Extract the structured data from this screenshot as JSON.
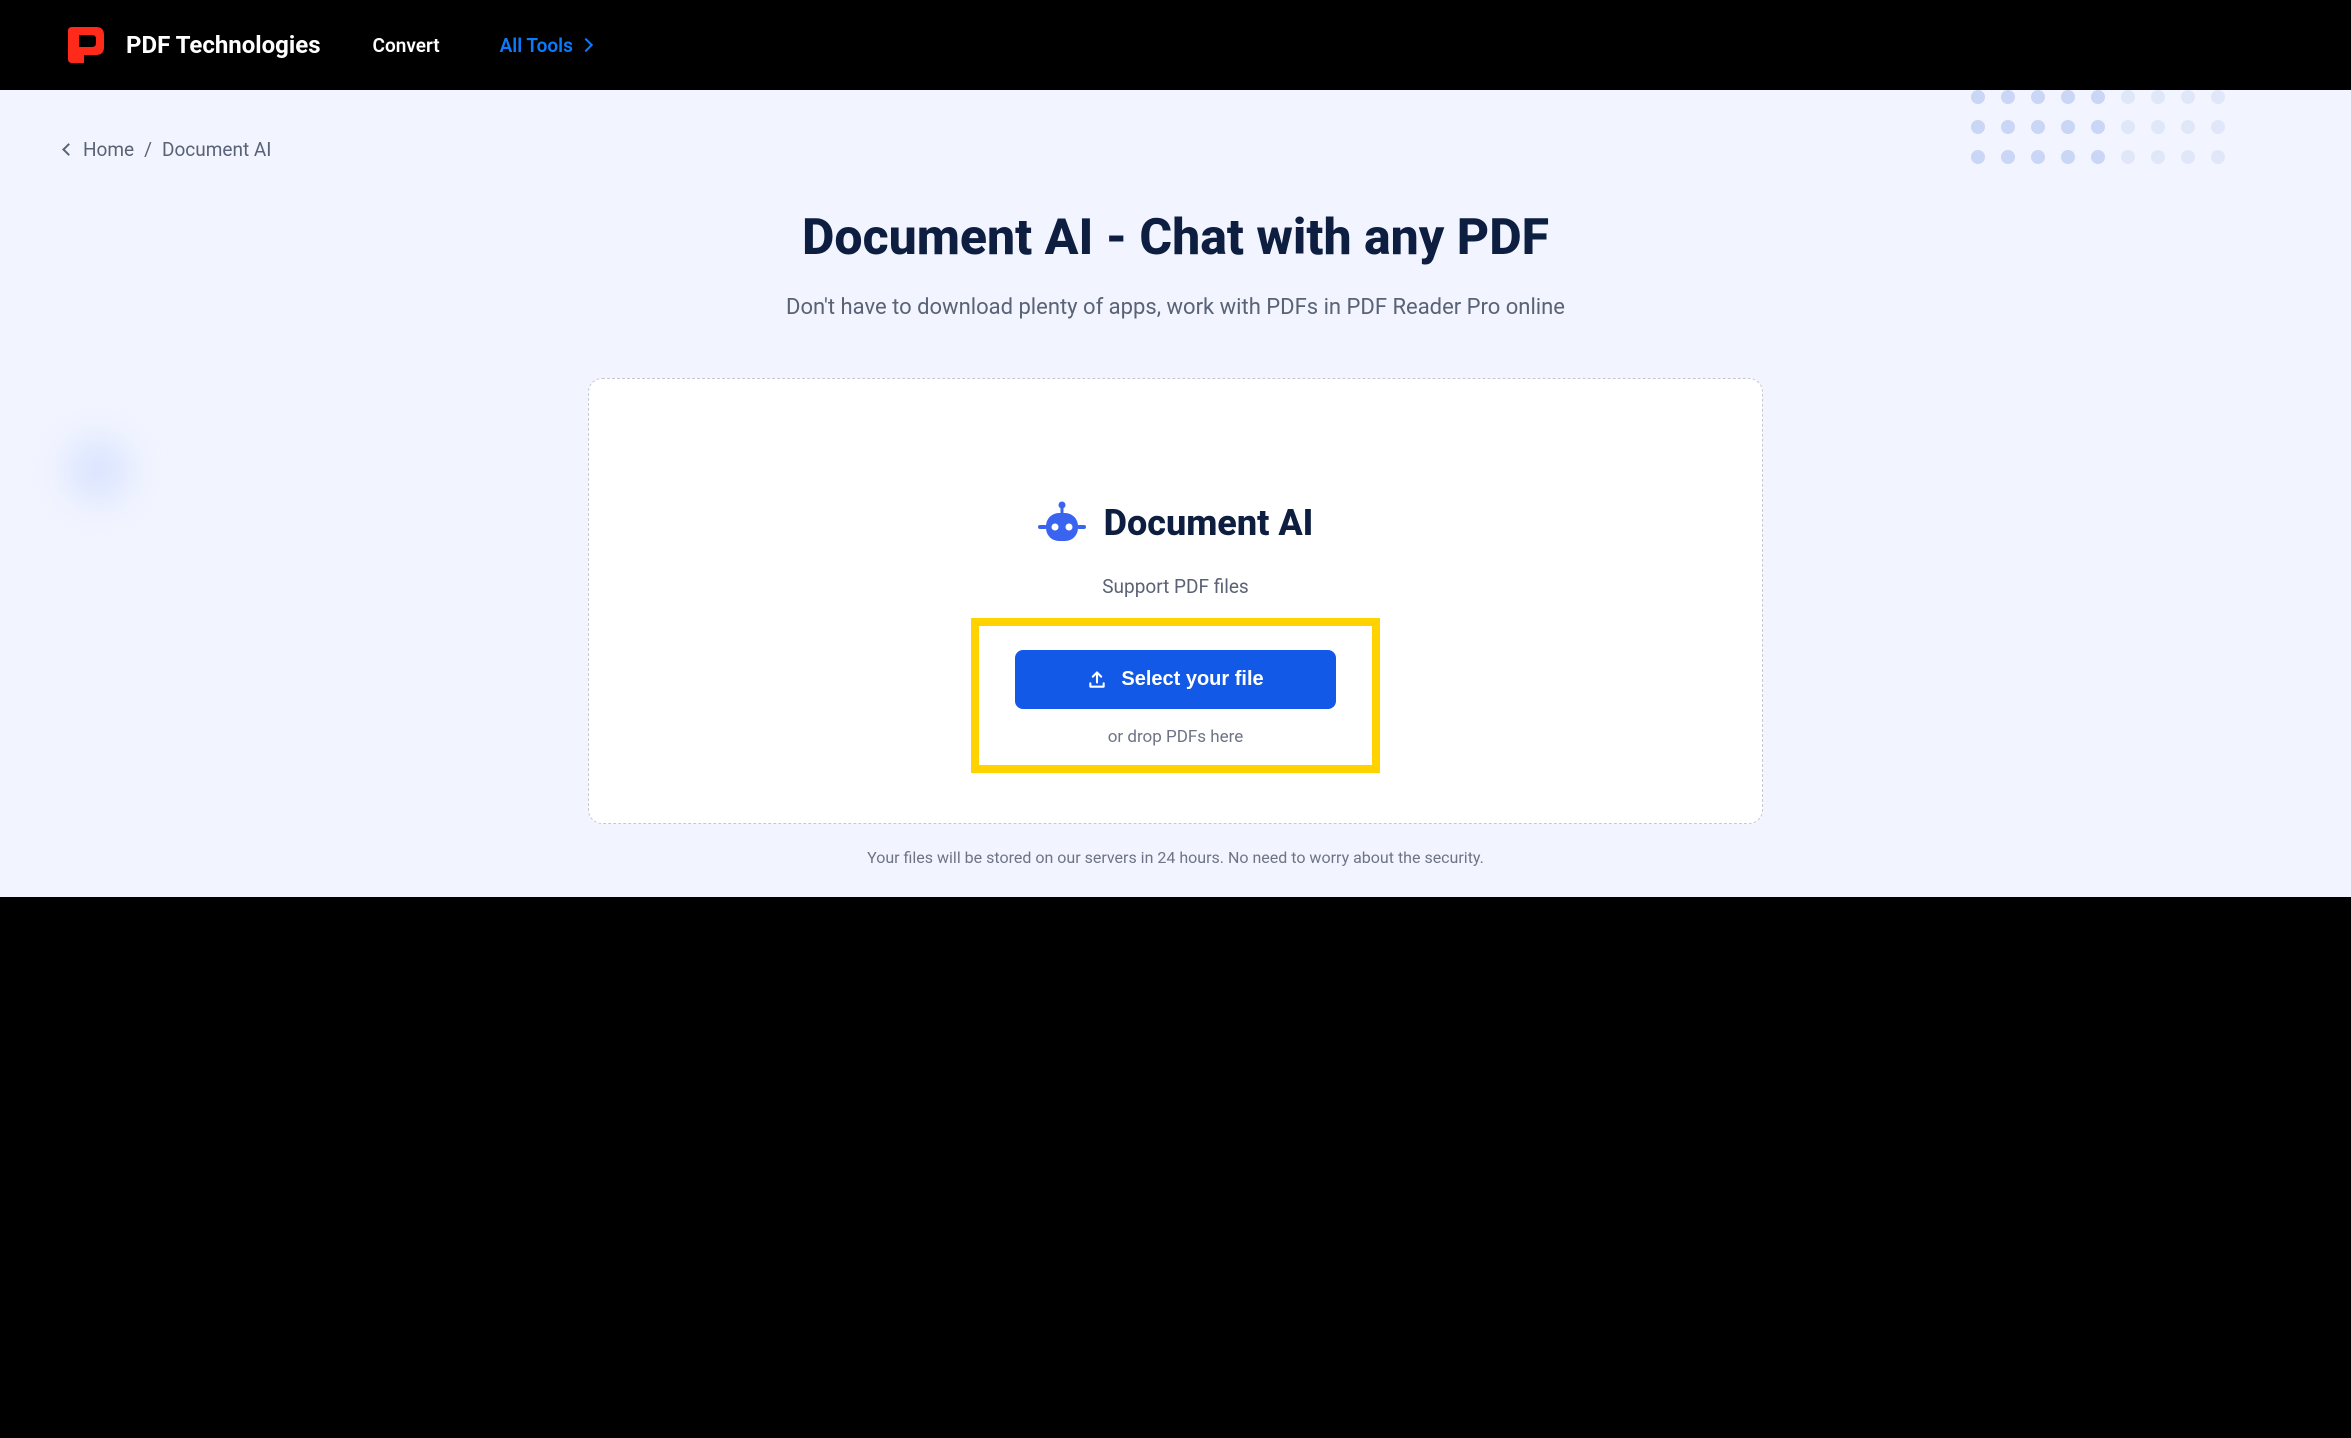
{
  "header": {
    "brand": "PDF Technologies",
    "nav": {
      "convert": "Convert",
      "all_tools": "All Tools"
    }
  },
  "breadcrumb": {
    "home": "Home",
    "separator": "/",
    "current": "Document AI"
  },
  "hero": {
    "title": "Document AI - Chat with any PDF",
    "subtitle": "Don't have to download plenty of apps, work with PDFs in PDF Reader Pro online"
  },
  "card": {
    "title": "Document AI",
    "support_text": "Support PDF files",
    "select_button": "Select your file",
    "drop_hint": "or drop PDFs here"
  },
  "footer": {
    "note": "Your files will be stored on our servers in 24 hours. No need to worry about the security."
  }
}
